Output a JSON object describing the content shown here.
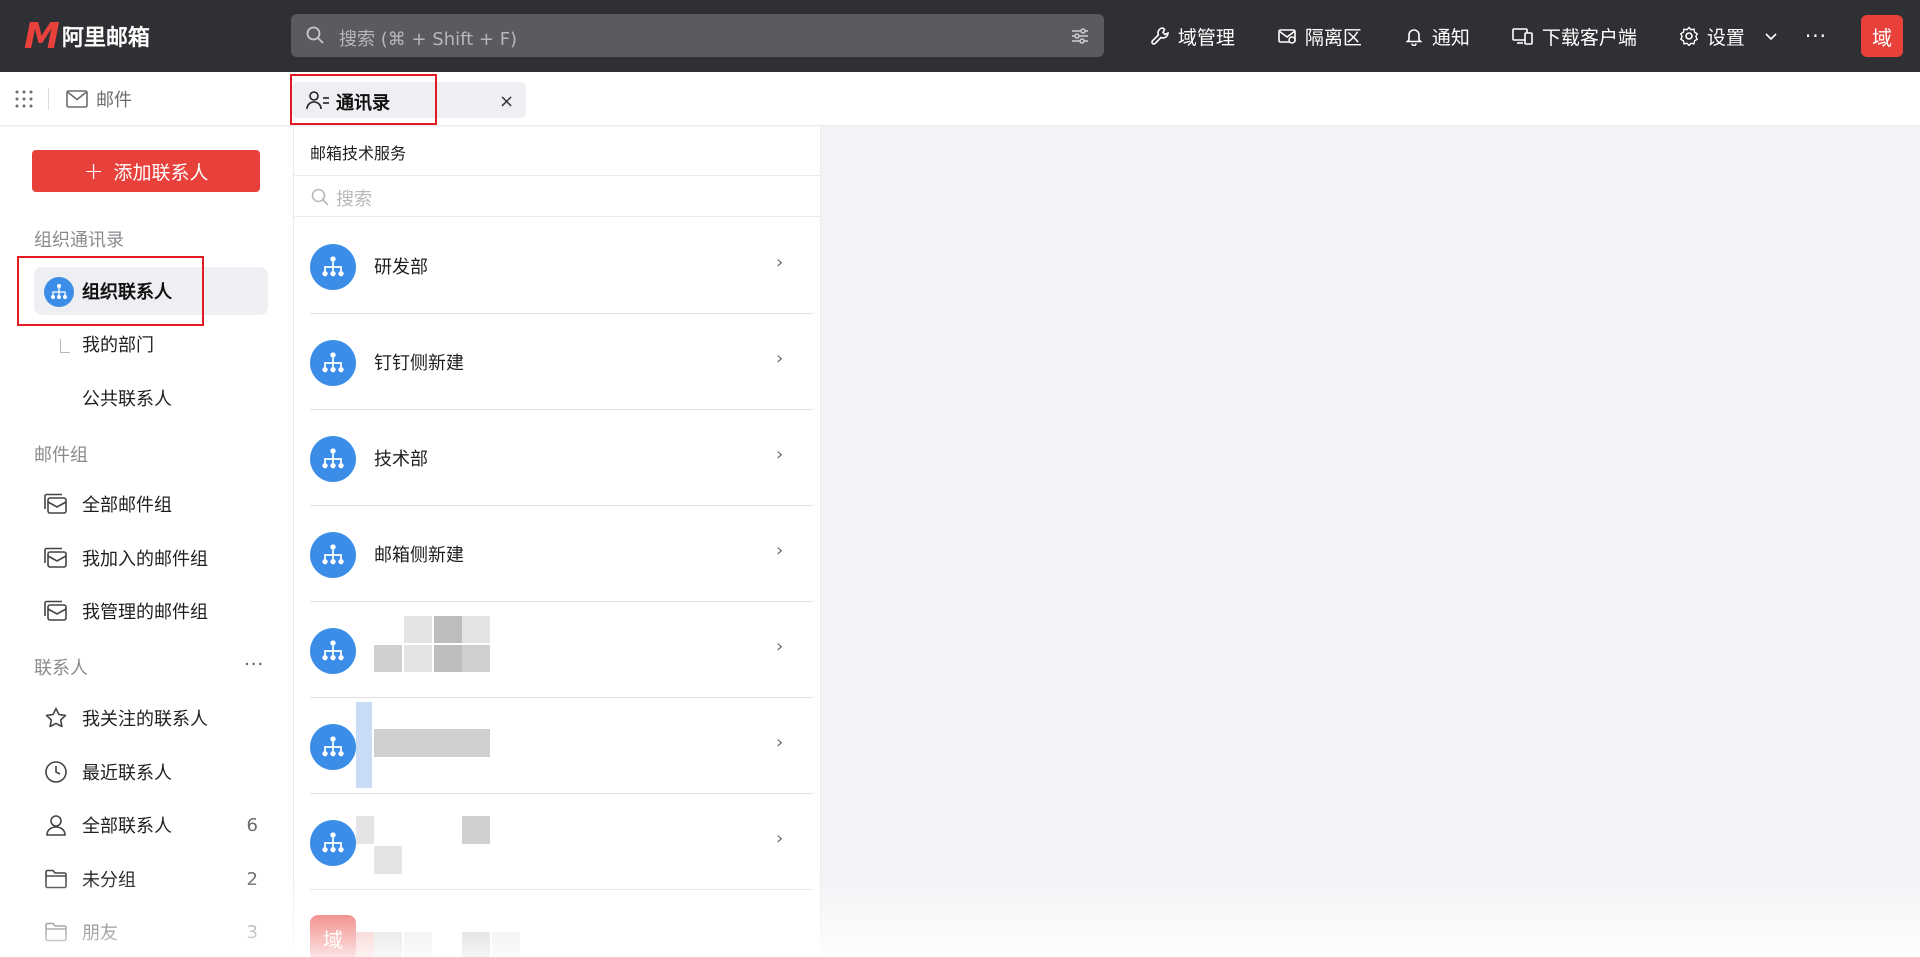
{
  "app": {
    "logo_mark": "M",
    "logo_text": "阿里邮箱"
  },
  "search": {
    "placeholder": "搜索 (⌘ + Shift + F)"
  },
  "top_actions": {
    "domain_manage": "域管理",
    "quarantine": "隔离区",
    "notify": "通知",
    "download_client": "下载客户端",
    "settings": "设置",
    "more": "···",
    "avatar": "域"
  },
  "tabs": {
    "mail": "邮件",
    "contacts": "通讯录",
    "close": "×"
  },
  "sidebar": {
    "add_contact": "添加联系人",
    "org_section": "组织通讯录",
    "org_contacts": "组织联系人",
    "my_dept": "我的部门",
    "public_contacts": "公共联系人",
    "group_section": "邮件组",
    "all_groups": "全部邮件组",
    "joined_groups": "我加入的邮件组",
    "managed_groups": "我管理的邮件组",
    "contacts_section": "联系人",
    "contacts_more": "···",
    "starred": "我关注的联系人",
    "recent": "最近联系人",
    "all_contacts": "全部联系人",
    "all_contacts_count": "6",
    "ungrouped": "未分组",
    "ungrouped_count": "2",
    "friends": "朋友",
    "friends_count": "3"
  },
  "list": {
    "title": "邮箱技术服务",
    "search_placeholder": "搜索",
    "departments": [
      "研发部",
      "钉钉侧新建",
      "技术部",
      "邮箱侧新建"
    ],
    "chevron": "›",
    "bottom_avatar": "域"
  },
  "colors": {
    "brand_red": "#e8413c",
    "dept_blue": "#3b8de8",
    "topbar_bg": "#2f3033",
    "highlight_box": "#e01b22"
  }
}
